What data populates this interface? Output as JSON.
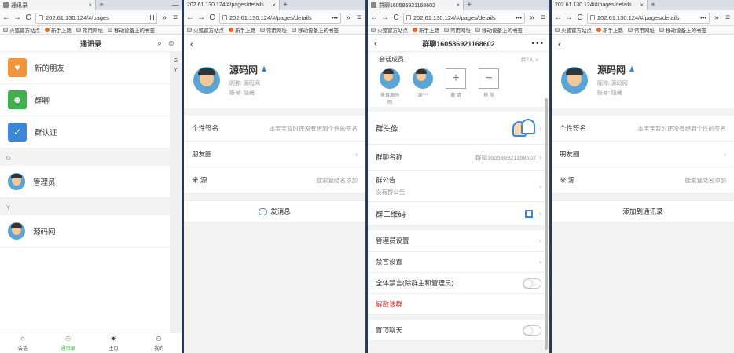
{
  "browser": {
    "back": "←",
    "forward": "→",
    "reload": "C",
    "more_arrows": "»",
    "menu": "≡",
    "dots": "•••",
    "close_tab": "×",
    "new_tab": "+",
    "minimize": "—",
    "bookmarks": [
      "火狐官方站点",
      "新手上路",
      "常用网址",
      "移动设备上的书签"
    ]
  },
  "win1": {
    "tab_title": "通讯录",
    "url": "202.61.130.124/#/pages",
    "header_title": "通讯录",
    "header_icons": "⌕ ☺",
    "items": [
      {
        "label": "新的朋友",
        "glyph": "♥"
      },
      {
        "label": "群聊",
        "glyph": "☻"
      },
      {
        "label": "群认证",
        "glyph": "✓"
      }
    ],
    "section_g": "G",
    "contact_g": "管理员",
    "section_y": "Y",
    "contact_y": "源码网",
    "alpha": [
      "G",
      "Y"
    ],
    "tabs": [
      {
        "label": "会话",
        "glyph": "○"
      },
      {
        "label": "通讯录",
        "glyph": "☺"
      },
      {
        "label": "主页",
        "glyph": "☀"
      },
      {
        "label": "我的",
        "glyph": "☺"
      }
    ]
  },
  "win2": {
    "tab_title": "202.61.130.124/#/pages/details",
    "url": "202.61.130.124/#/pages/details",
    "name": "源码网",
    "nickname": "昵称: 源码网",
    "account": "账号: 隐藏",
    "sign_label": "个性签名",
    "sign_value": "本宝宝暂时还没有想到个性的签名",
    "moments_label": "朋友圈",
    "source_label": "来 源",
    "source_value": "搜索登陆名添加",
    "action": "发消息"
  },
  "win3": {
    "tab_title": "群聊160586921168602",
    "url": "202.61.130.124/#/pages/details",
    "header_title": "群聊160586921168602",
    "members_label": "会话成员",
    "members_count": "共2人 >",
    "members": [
      {
        "name": "来自源码网"
      },
      {
        "name": "源***"
      }
    ],
    "invite": "邀 请",
    "remove": "移 除",
    "avatar_label": "群头像",
    "name_label": "群聊名称",
    "name_value": "群聊160586921168602",
    "notice_label": "群公告",
    "notice_value": "没有群公告",
    "qr_label": "群二维码",
    "admin_label": "管理员设置",
    "mute_label": "禁言设置",
    "mute_all_label": "全体禁言(除群主和管理员)",
    "dissolve": "解散该群",
    "pin_label": "置顶聊天"
  },
  "win4": {
    "tab_title": "202.61.130.124/#/pages/details",
    "url": "202.61.130.124/#/pages/details",
    "name": "源码网",
    "nickname": "昵称: 源码网",
    "account": "账号: 隐藏",
    "sign_label": "个性签名",
    "sign_value": "本宝宝暂时还没有想到个性的签名",
    "moments_label": "朋友圈",
    "source_label": "来 源",
    "source_value": "搜索登陆名添加",
    "action": "添加到通讯录"
  }
}
